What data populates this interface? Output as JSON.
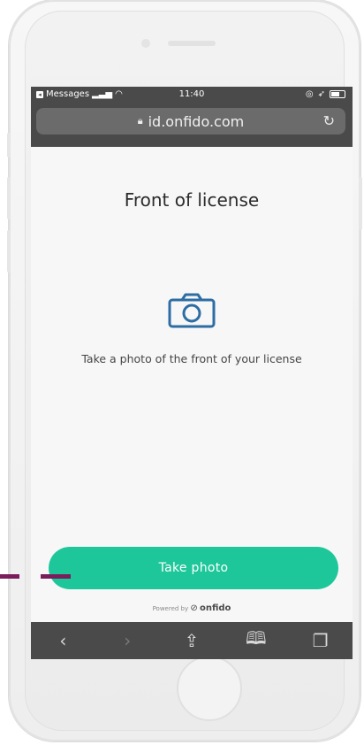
{
  "statusbar": {
    "back_app": "Messages",
    "time": "11:40"
  },
  "browser": {
    "url": "id.onfido.com"
  },
  "page": {
    "title": "Front of license",
    "instruction": "Take a photo of the front of your license",
    "cta_label": "Take photo",
    "powered_by": "Powered by",
    "brand": "onfido"
  },
  "icons": {
    "camera": "camera-icon",
    "lock": "lock-icon",
    "reload": "reload-icon",
    "back": "back-arrow-icon",
    "forward": "forward-arrow-icon",
    "share": "share-icon",
    "bookmarks": "bookmarks-icon",
    "tabs": "tabs-icon"
  },
  "colors": {
    "accent": "#1ec79a",
    "camera_icon": "#2e6da4",
    "browser_chrome": "#4a4a4a",
    "callout": "#7a1d5a"
  }
}
